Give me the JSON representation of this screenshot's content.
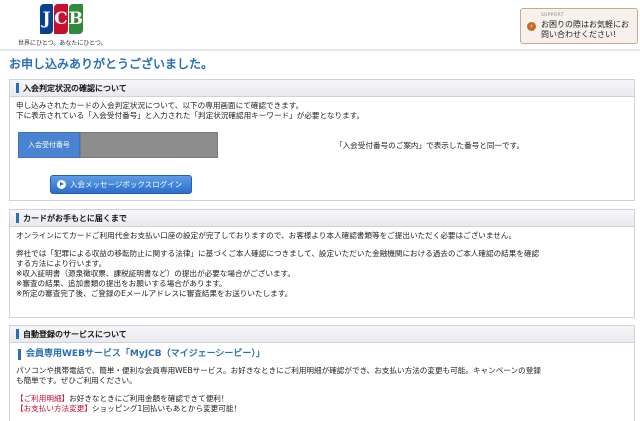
{
  "header": {
    "logo_letters": [
      "J",
      "C",
      "B"
    ],
    "slogan": "世界にひとつ。あなたにひとつ。",
    "support": {
      "small_label": "SUPPORT",
      "text": "お困りの際はお気軽にお問い合わせください!"
    }
  },
  "page_title": "お申し込みありがとうございました。",
  "section1": {
    "heading": "入会判定状況の確認について",
    "line1": "申し込みされたカードの入会判定状況について、以下の専用画面にて確認できます。",
    "line2": "下に表示されている「入会受付番号」と入力された「判定状況確認用キーワード」が必要となります。",
    "acceptance_label": "入会受付番号",
    "acceptance_value": "",
    "acceptance_note": "「入会受付番号のご案内」で表示した番号と同一です。",
    "login_button": "入会メッセージボックスログイン"
  },
  "section2": {
    "heading": "カードがお手もとに届くまで",
    "para1": "オンラインにてカードご利用代金お支払い口座の設定が完了しておりますので、お客様より本人確認書類等をご提出いただく必要はございません。",
    "para2_line1": "弊社では「犯罪による収益の移転防止に関する法律」に基づくご本人確認につきまして、設定いただいた金融機関における過去のご本人確認の結果を確認",
    "para2_line2": "する方法により行います。",
    "note1": "※収入証明書（源泉徴収票、課税証明書など）の提出が必要な場合がございます。",
    "note2": "※審査の結果、追加書類の提出をお願いする場合があります。",
    "note3": "※所定の審査完了後、ご登録のEメールアドレスに審査結果をお送りいたします。"
  },
  "section3": {
    "heading": "自動登録のサービスについて",
    "service_title": "会員専用WEBサービス「MyJCB（マイジェーシービー）」",
    "desc_line1": "パソコンや携帯電話で、簡単・便利な会員専用WEBサービス。お好きなときにご利用明細が確認ができ、お支払い方法の変更も可能。キャンペーンの登録",
    "desc_line2": "も簡単です。ぜひご利用ください。",
    "feature1_tag": "【ご利用明細】",
    "feature1_text": "お好きなときにご利用金額を確認できて便利！",
    "feature2_tag": "【お支払い方法変更】",
    "feature2_text": "ショッピング1回払いもあとから変更可能！"
  },
  "colors": {
    "accent_blue": "#2a6fb5",
    "label_blue": "#4a84d0",
    "jcb_blue": "#0b3f8f",
    "jcb_red": "#c8102e",
    "jcb_green": "#2f8a3a"
  }
}
